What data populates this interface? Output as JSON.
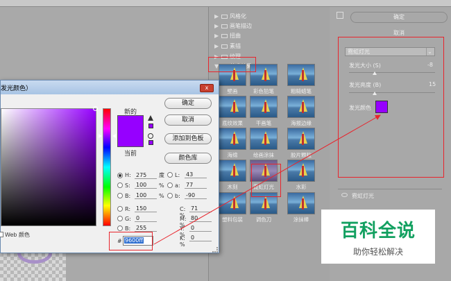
{
  "colors": {
    "picked": "#9600ff",
    "annotation_red": "#e8242c",
    "watermark_green": "#12a060"
  },
  "gallery": {
    "folders": [
      {
        "label": "风格化",
        "expanded": false
      },
      {
        "label": "画笔描边",
        "expanded": false
      },
      {
        "label": "扭曲",
        "expanded": false
      },
      {
        "label": "素描",
        "expanded": false
      },
      {
        "label": "纹理",
        "expanded": false
      },
      {
        "label": "艺术效果",
        "expanded": true
      }
    ],
    "thumbs": [
      {
        "label": "壁画"
      },
      {
        "label": "彩色铅笔"
      },
      {
        "label": "粗糙蜡笔"
      },
      {
        "label": "底纹效果"
      },
      {
        "label": "干画笔"
      },
      {
        "label": "海报边缘"
      },
      {
        "label": "海绵"
      },
      {
        "label": "绘画涂抹"
      },
      {
        "label": "胶片颗粒"
      },
      {
        "label": "木刻"
      },
      {
        "label": "霓虹灯光"
      },
      {
        "label": "水彩"
      },
      {
        "label": "塑料包装"
      },
      {
        "label": "调色刀"
      },
      {
        "label": "涂抹棒"
      }
    ]
  },
  "right_panel": {
    "ok_label": "确定",
    "cancel_label": "取消",
    "filter_name": "霓虹灯光",
    "glow_size_label": "发光大小 (S)",
    "glow_size_value": "-8",
    "glow_size_fraction": 0.3,
    "glow_brightness_label": "发光亮度 (B)",
    "glow_brightness_value": "15",
    "glow_brightness_fraction": 0.3,
    "glow_color_label": "发光颜色",
    "layer_name": "霓虹灯光"
  },
  "dialog": {
    "title": "发光颜色）",
    "close_label": "x",
    "new_label": "新的",
    "current_label": "当前",
    "buttons": {
      "ok": "确定",
      "cancel": "取消",
      "add_swatch": "添加到色板",
      "library": "颜色库"
    },
    "hsb": [
      {
        "name": "H:",
        "value": "275",
        "unit": "度",
        "selected": true
      },
      {
        "name": "S:",
        "value": "100",
        "unit": "%",
        "selected": false
      },
      {
        "name": "B:",
        "value": "100",
        "unit": "%",
        "selected": false
      }
    ],
    "rgb": [
      {
        "name": "R:",
        "value": "150"
      },
      {
        "name": "G:",
        "value": "0"
      },
      {
        "name": "B:",
        "value": "255"
      }
    ],
    "lab": [
      {
        "name": "L:",
        "value": "43"
      },
      {
        "name": "a:",
        "value": "77"
      },
      {
        "name": "b:",
        "value": "-90"
      }
    ],
    "cmyk": [
      {
        "name": "C:",
        "value": "71",
        "unit": "%"
      },
      {
        "name": "M:",
        "value": "80",
        "unit": "%"
      },
      {
        "name": "Y:",
        "value": "0",
        "unit": "%"
      },
      {
        "name": "K:",
        "value": "0",
        "unit": "%"
      }
    ],
    "web_only_label": "Web 颜色",
    "hex_hash": "#",
    "hex_value": "9600ff"
  },
  "watermark": {
    "title": "百科全说",
    "subtitle": "助你轻松解决"
  }
}
